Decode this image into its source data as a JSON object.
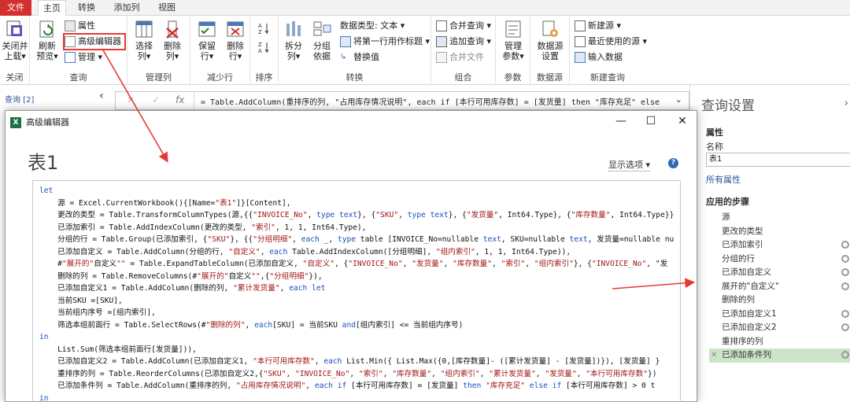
{
  "menu": {
    "file": "文件",
    "tabs": [
      "主页",
      "转换",
      "添加列",
      "视图"
    ]
  },
  "ribbon": {
    "groups": {
      "close": "关闭",
      "query": "查询",
      "manage_columns": "管理列",
      "reduce_rows": "减少行",
      "sort": "排序",
      "transform": "转换",
      "combine": "组合",
      "params": "参数",
      "datasource": "数据源",
      "new_query": "新建查询"
    },
    "close_load": [
      "关闭并",
      "上载▾"
    ],
    "refresh_preview": [
      "刷新",
      "预览▾"
    ],
    "properties": "属性",
    "advanced_editor": "高级编辑器",
    "manage": "管理 ▾",
    "choose_cols": [
      "选择",
      "列▾"
    ],
    "remove_cols": [
      "删除",
      "列▾"
    ],
    "keep_rows": [
      "保留",
      "行▾"
    ],
    "remove_rows": [
      "删除",
      "行▾"
    ],
    "split_col": [
      "拆分",
      "列▾"
    ],
    "group_by": [
      "分组",
      "依据"
    ],
    "data_type": "数据类型: 文本 ▾",
    "first_row_header": "将第一行用作标题 ▾",
    "replace_values": "替换值",
    "merge_queries": "合并查询 ▾",
    "append_queries": "追加查询 ▾",
    "combine_files": "合并文件",
    "manage_params": [
      "管理",
      "参数▾"
    ],
    "ds_settings": [
      "数据源",
      "设置"
    ],
    "new_source": "新建源 ▾",
    "recent_sources": "最近使用的源 ▾",
    "enter_data": "输入数据"
  },
  "queries_label": "查询 [2]",
  "formula_bar": {
    "fx": "fx",
    "text": "= Table.AddColumn(重排序的列, \"占用库存情况说明\", each if [本行可用库存数] = [发货量] then \"库存充足\" else"
  },
  "dialog": {
    "window_title": "高级编辑器",
    "heading": "表1",
    "display_options": "显示选项 ▾",
    "help": "?",
    "code_lines": [
      "let",
      "    源 = Excel.CurrentWorkbook(){[Name=\"表1\"]}[Content],",
      "    更改的类型 = Table.TransformColumnTypes(源,{{\"INVOICE_No\", type text}, {\"SKU\", type text}, {\"发货量\", Int64.Type}, {\"库存数量\", Int64.Type}}",
      "    已添加索引 = Table.AddIndexColumn(更改的类型, \"索引\", 1, 1, Int64.Type),",
      "    分组的行 = Table.Group(已添加索引, {\"SKU\"}, {{\"分组明细\", each _, type table [INVOICE_No=nullable text, SKU=nullable text, 发货量=nullable nu",
      "    已添加自定义 = Table.AddColumn(分组的行, \"自定义\", each Table.AddIndexColumn([分组明细], \"组内索引\", 1, 1, Int64.Type)),",
      "    #\"展开的\"自定义\"\" = Table.ExpandTableColumn(已添加自定义, \"自定义\", {\"INVOICE_No\", \"发货量\", \"库存数量\", \"索引\", \"组内索引\"}, {\"INVOICE_No\", \"发",
      "    删除的列 = Table.RemoveColumns(#\"展开的\"自定义\"\",{\"分组明细\"}),",
      "    已添加自定义1 = Table.AddColumn(删除的列, \"累计发货量\", each let",
      "    当前SKU =[SKU],",
      "    当前组内序号 =[组内索引],",
      "    筛选本组前面行 = Table.SelectRows(#\"删除的列\", each[SKU] = 当前SKU and[组内索引] <= 当前组内序号)",
      "in",
      "    List.Sum(筛选本组前面行[发货量])),",
      "    已添加自定义2 = Table.AddColumn(已添加自定义1, \"本行可用库存数\", each List.Min({ List.Max({0,[库存数量]- ([累计发货量] - [发货量])}), [发货量] }",
      "    重排序的列 = Table.ReorderColumns(已添加自定义2,{\"SKU\", \"INVOICE_No\", \"索引\", \"库存数量\", \"组内索引\", \"累计发货量\", \"发货量\", \"本行可用库存数\"})",
      "    已添加条件列 = Table.AddColumn(重排序的列, \"占用库存情况说明\", each if [本行可用库存数] = [发货量] then \"库存充足\" else if [本行可用库存数] > 0 t",
      "in",
      "    已添加条件列"
    ]
  },
  "settings": {
    "title": "查询设置",
    "properties": "属性",
    "name_label": "名称",
    "name_value": "表1",
    "all_properties": "所有属性",
    "applied_steps": "应用的步骤",
    "steps": [
      {
        "label": "源",
        "gear": false
      },
      {
        "label": "更改的类型",
        "gear": false
      },
      {
        "label": "已添加索引",
        "gear": true
      },
      {
        "label": "分组的行",
        "gear": true
      },
      {
        "label": "已添加自定义",
        "gear": true
      },
      {
        "label": "展开的\"自定义\"",
        "gear": true
      },
      {
        "label": "删除的列",
        "gear": false
      },
      {
        "label": "已添加自定义1",
        "gear": true
      },
      {
        "label": "已添加自定义2",
        "gear": true
      },
      {
        "label": "重排序的列",
        "gear": false
      },
      {
        "label": "已添加条件列",
        "gear": true,
        "selected": true
      }
    ]
  },
  "colors": {
    "accent_red": "#e53935",
    "file_tab": "#d32f2f",
    "selected_step": "#cce4c8",
    "link": "#2b5797"
  }
}
